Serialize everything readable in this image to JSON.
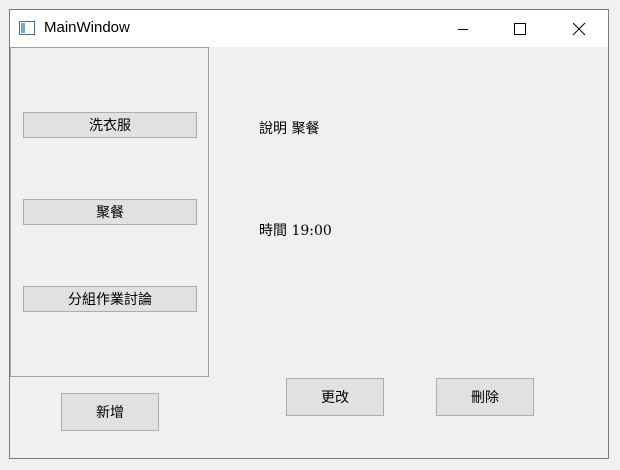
{
  "window": {
    "title": "MainWindow"
  },
  "tasks": [
    {
      "label": "洗衣服"
    },
    {
      "label": "聚餐"
    },
    {
      "label": "分組作業討論"
    }
  ],
  "detail": {
    "description": "說明 聚餐",
    "time": "時間 19:00"
  },
  "buttons": {
    "add": "新增",
    "edit": "更改",
    "delete": "刪除"
  }
}
